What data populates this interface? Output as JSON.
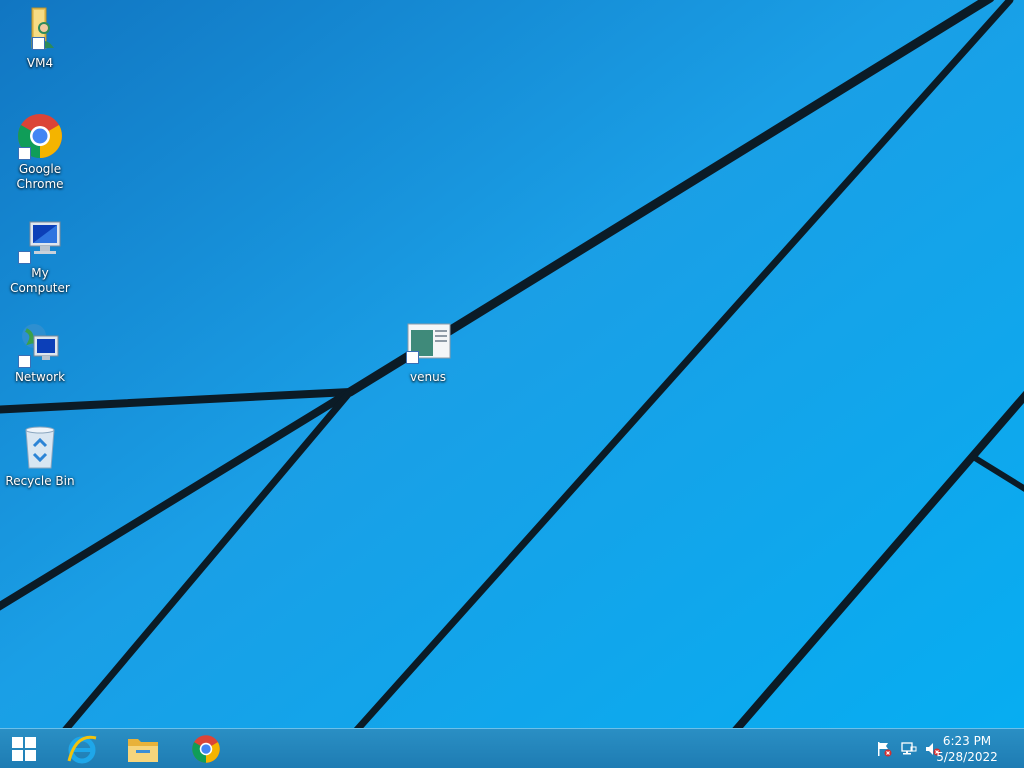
{
  "desktop": {
    "icons": [
      {
        "label": "VM4",
        "icon": "user-folder-icon"
      },
      {
        "label": "Google Chrome",
        "icon": "chrome-icon"
      },
      {
        "label": "My Computer",
        "icon": "computer-icon"
      },
      {
        "label": "Network",
        "icon": "network-icon"
      },
      {
        "label": "Recycle Bin",
        "icon": "recycle-bin-icon"
      },
      {
        "label": "venus",
        "icon": "remote-desktop-icon"
      }
    ]
  },
  "taskbar": {
    "pinned": [
      {
        "name": "start",
        "icon": "windows-logo-icon"
      },
      {
        "name": "internet-explorer",
        "icon": "internet-explorer-icon"
      },
      {
        "name": "file-explorer",
        "icon": "file-explorer-icon"
      },
      {
        "name": "chrome",
        "icon": "chrome-icon"
      }
    ],
    "tray": {
      "icons": [
        "action-center-flag-icon",
        "network-status-icon",
        "volume-muted-icon"
      ],
      "time": "6:23 PM",
      "date": "5/28/2022"
    }
  },
  "colors": {
    "wallpaper": "#12a6ee",
    "stripes": "#0b1b26",
    "taskbar": "#1e7cb3"
  }
}
